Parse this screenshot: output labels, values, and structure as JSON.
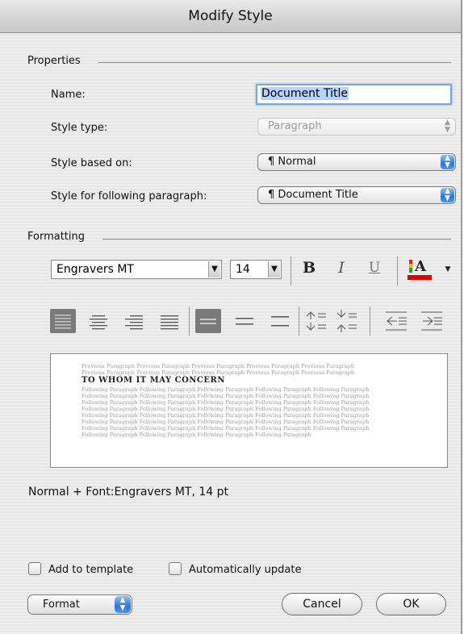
{
  "window": {
    "title": "Modify Style"
  },
  "properties": {
    "section_label": "Properties",
    "name_label": "Name:",
    "name_value": "Document Title",
    "style_type_label": "Style type:",
    "style_type_value": "Paragraph",
    "based_on_label": "Style based on:",
    "based_on_value": "¶ Normal",
    "following_label": "Style for following paragraph:",
    "following_value": "¶ Document Title"
  },
  "formatting": {
    "section_label": "Formatting",
    "font_name": "Engravers MT",
    "font_size": "14",
    "bold_label": "B",
    "italic_label": "I",
    "underline_label": "U",
    "font_color_label": "A",
    "font_color": "#e00000"
  },
  "preview": {
    "previous_lines": [
      "Previous Paragraph Previous Paragraph Previous Paragraph Previous Paragraph Previous Paragraph",
      "Previous Paragraph Previous Paragraph Previous Paragraph Previous Paragraph Previous Paragraph"
    ],
    "title_text": "TO WHOM IT MAY CONCERN",
    "following_lines": [
      "Following Paragraph Following Paragraph Following Paragraph Following Paragraph Following Paragraph",
      "Following Paragraph Following Paragraph Following Paragraph Following Paragraph Following Paragraph",
      "Following Paragraph Following Paragraph Following Paragraph Following Paragraph Following Paragraph",
      "Following Paragraph Following Paragraph Following Paragraph Following Paragraph Following Paragraph",
      "Following Paragraph Following Paragraph Following Paragraph Following Paragraph Following Paragraph",
      "Following Paragraph Following Paragraph Following Paragraph Following Paragraph Following Paragraph",
      "Following Paragraph Following Paragraph Following Paragraph Following Paragraph Following Paragraph",
      "Following Paragraph Following Paragraph Following Paragraph Following Paragraph"
    ]
  },
  "description": "Normal + Font:Engravers MT, 14 pt",
  "options": {
    "add_to_template": "Add to template",
    "auto_update": "Automatically update"
  },
  "buttons": {
    "format": "Format",
    "cancel": "Cancel",
    "ok": "OK"
  }
}
